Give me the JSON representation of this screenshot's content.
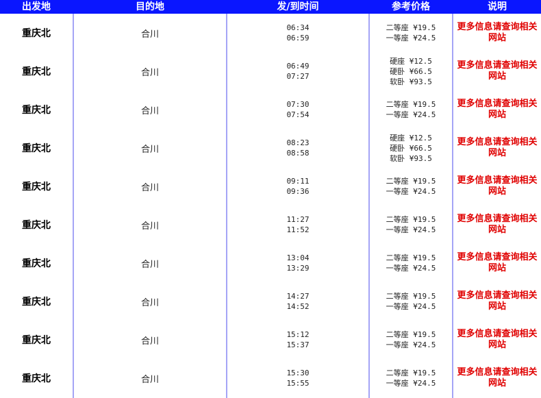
{
  "headers": {
    "origin": "出发地",
    "destination": "目的地",
    "times": "发/到时间",
    "price": "参考价格",
    "note": "说明"
  },
  "colors": {
    "header_bg": "#0a16ff",
    "divider": "#a4a4f6",
    "note_text": "#e00000"
  },
  "rows": [
    {
      "origin": "重庆北",
      "destination": "合川",
      "depart": "06:34",
      "arrive": "06:59",
      "prices": [
        "二等座 ¥19.5",
        "一等座 ¥24.5"
      ],
      "note": "更多信息请查询相关网站"
    },
    {
      "origin": "重庆北",
      "destination": "合川",
      "depart": "06:49",
      "arrive": "07:27",
      "prices": [
        "硬座 ¥12.5",
        "硬卧 ¥66.5",
        "软卧 ¥93.5"
      ],
      "note": "更多信息请查询相关网站"
    },
    {
      "origin": "重庆北",
      "destination": "合川",
      "depart": "07:30",
      "arrive": "07:54",
      "prices": [
        "二等座 ¥19.5",
        "一等座 ¥24.5"
      ],
      "note": "更多信息请查询相关网站"
    },
    {
      "origin": "重庆北",
      "destination": "合川",
      "depart": "08:23",
      "arrive": "08:58",
      "prices": [
        "硬座 ¥12.5",
        "硬卧 ¥66.5",
        "软卧 ¥93.5"
      ],
      "note": "更多信息请查询相关网站"
    },
    {
      "origin": "重庆北",
      "destination": "合川",
      "depart": "09:11",
      "arrive": "09:36",
      "prices": [
        "二等座 ¥19.5",
        "一等座 ¥24.5"
      ],
      "note": "更多信息请查询相关网站"
    },
    {
      "origin": "重庆北",
      "destination": "合川",
      "depart": "11:27",
      "arrive": "11:52",
      "prices": [
        "二等座 ¥19.5",
        "一等座 ¥24.5"
      ],
      "note": "更多信息请查询相关网站"
    },
    {
      "origin": "重庆北",
      "destination": "合川",
      "depart": "13:04",
      "arrive": "13:29",
      "prices": [
        "二等座 ¥19.5",
        "一等座 ¥24.5"
      ],
      "note": "更多信息请查询相关网站"
    },
    {
      "origin": "重庆北",
      "destination": "合川",
      "depart": "14:27",
      "arrive": "14:52",
      "prices": [
        "二等座 ¥19.5",
        "一等座 ¥24.5"
      ],
      "note": "更多信息请查询相关网站"
    },
    {
      "origin": "重庆北",
      "destination": "合川",
      "depart": "15:12",
      "arrive": "15:37",
      "prices": [
        "二等座 ¥19.5",
        "一等座 ¥24.5"
      ],
      "note": "更多信息请查询相关网站"
    },
    {
      "origin": "重庆北",
      "destination": "合川",
      "depart": "15:30",
      "arrive": "15:55",
      "prices": [
        "二等座 ¥19.5",
        "一等座 ¥24.5"
      ],
      "note": "更多信息请查询相关网站"
    }
  ]
}
